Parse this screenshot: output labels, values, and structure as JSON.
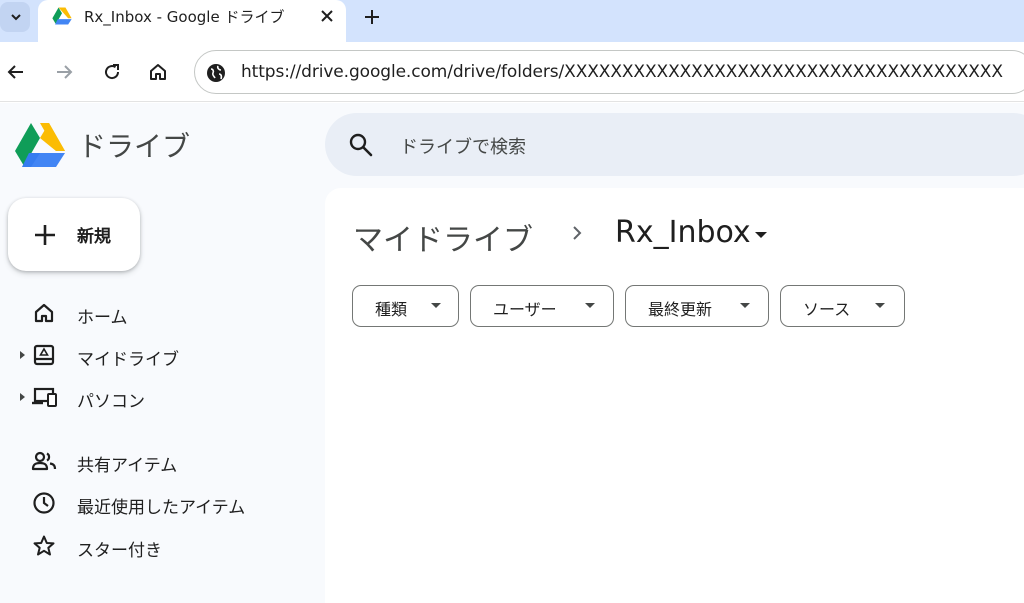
{
  "browser": {
    "tab_title": "Rx_Inbox - Google ドライブ",
    "url": "https://drive.google.com/drive/folders/XXXXXXXXXXXXXXXXXXXXXXXXXXXXXXXXXXXXXX"
  },
  "app": {
    "product_name": "ドライブ",
    "search_placeholder": "ドライブで検索",
    "new_label": "新規"
  },
  "sidebar": {
    "items": [
      {
        "label": "ホーム",
        "icon": "home-icon",
        "expandable": false
      },
      {
        "label": "マイドライブ",
        "icon": "my-drive-icon",
        "expandable": true
      },
      {
        "label": "パソコン",
        "icon": "computers-icon",
        "expandable": true
      },
      {
        "label": "共有アイテム",
        "icon": "shared-people-icon",
        "expandable": false
      },
      {
        "label": "最近使用したアイテム",
        "icon": "clock-icon",
        "expandable": false
      },
      {
        "label": "スター付き",
        "icon": "star-icon",
        "expandable": false
      }
    ]
  },
  "main": {
    "breadcrumb": {
      "root": "マイドライブ",
      "current": "Rx_Inbox"
    },
    "filters": [
      {
        "label": "種類"
      },
      {
        "label": "ユーザー"
      },
      {
        "label": "最終更新"
      },
      {
        "label": "ソース"
      }
    ]
  },
  "colors": {
    "tabstrip": "#d3e3fd",
    "app_background": "#f8fafd",
    "search_background": "#e9eef6",
    "text_primary": "#1f1f1f",
    "text_secondary": "#444746"
  }
}
